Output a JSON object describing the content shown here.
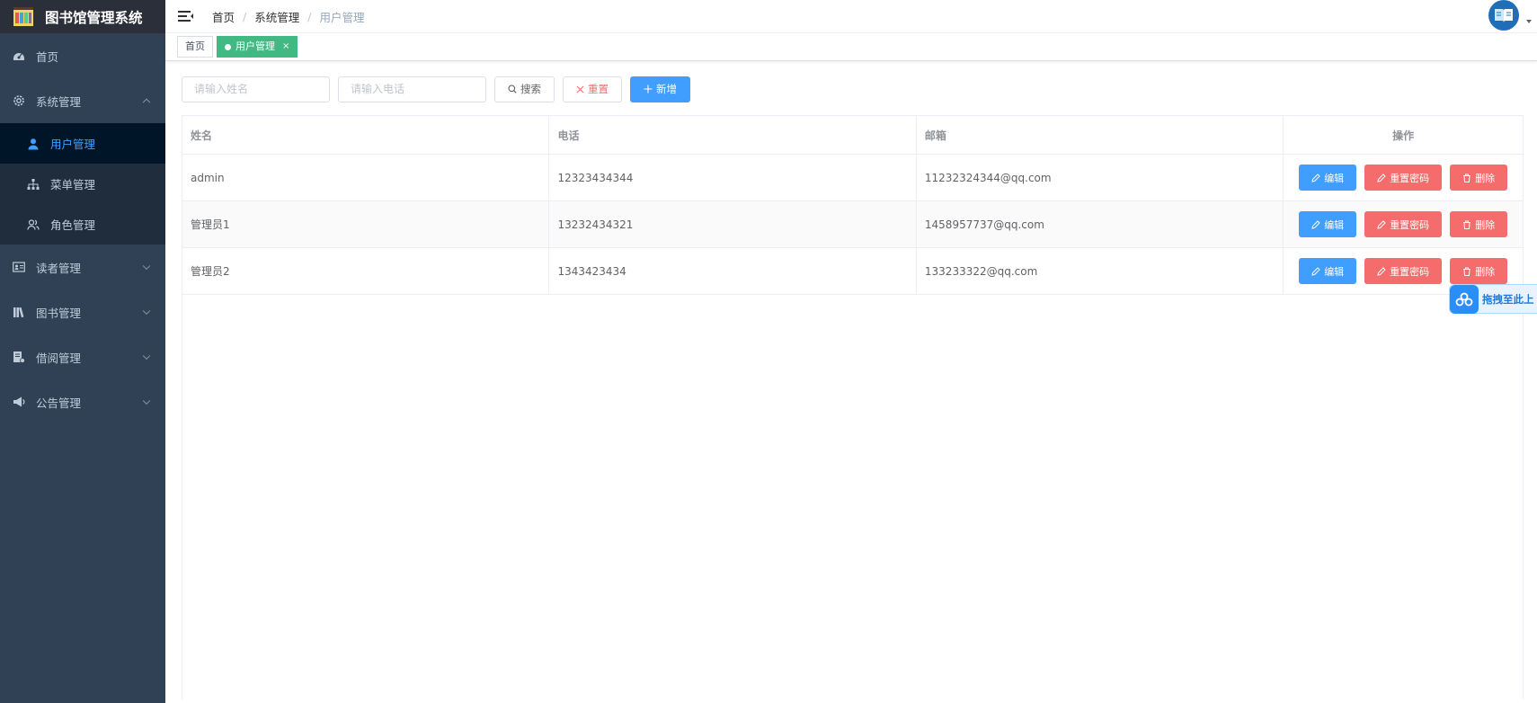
{
  "app": {
    "title": "图书馆管理系统"
  },
  "sidebar": {
    "items": [
      {
        "label": "首页",
        "icon": "dashboard-icon"
      },
      {
        "label": "系统管理",
        "icon": "gear-icon",
        "expanded": true,
        "children": [
          {
            "label": "用户管理",
            "icon": "user-icon",
            "active": true
          },
          {
            "label": "菜单管理",
            "icon": "tree-icon"
          },
          {
            "label": "角色管理",
            "icon": "peoples-icon"
          }
        ]
      },
      {
        "label": "读者管理",
        "icon": "id-card-icon"
      },
      {
        "label": "图书管理",
        "icon": "books-icon"
      },
      {
        "label": "借阅管理",
        "icon": "borrow-icon"
      },
      {
        "label": "公告管理",
        "icon": "megaphone-icon"
      }
    ]
  },
  "navbar": {
    "breadcrumb": [
      "首页",
      "系统管理",
      "用户管理"
    ]
  },
  "tags": [
    {
      "label": "首页",
      "active": false
    },
    {
      "label": "用户管理",
      "active": true,
      "close": "×"
    }
  ],
  "search": {
    "name_placeholder": "请输入姓名",
    "phone_placeholder": "请输入电话",
    "search_label": "搜索",
    "reset_label": "重置",
    "add_label": "新增"
  },
  "table": {
    "columns": [
      "姓名",
      "电话",
      "邮箱",
      "操作"
    ],
    "rows": [
      {
        "name": "admin",
        "phone": "12323434344",
        "email": "11232324344@qq.com"
      },
      {
        "name": "管理员1",
        "phone": "13232434321",
        "email": "1458957737@qq.com"
      },
      {
        "name": "管理员2",
        "phone": "1343423434",
        "email": "133233322@qq.com"
      }
    ],
    "actions": {
      "edit": "编辑",
      "reset_pwd": "重置密码",
      "delete": "删除"
    }
  },
  "float_widget": {
    "label": "拖拽至此上"
  },
  "colors": {
    "sidebar": "#304156",
    "primary": "#409eff",
    "danger": "#f56c6c",
    "tag_active": "#42b983"
  }
}
